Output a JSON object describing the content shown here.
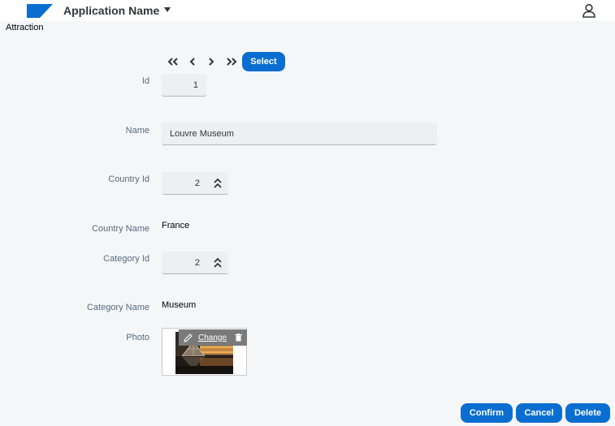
{
  "shell": {
    "app_name": "Application Name"
  },
  "page": {
    "title": "Attraction"
  },
  "nav": {
    "select_label": "Select"
  },
  "form": {
    "id": {
      "label": "Id",
      "value": "1"
    },
    "name": {
      "label": "Name",
      "value": "Louvre Museum"
    },
    "country_id": {
      "label": "Country Id",
      "value": "2"
    },
    "country_name": {
      "label": "Country Name",
      "value": "France"
    },
    "category_id": {
      "label": "Category Id",
      "value": "2"
    },
    "category_name": {
      "label": "Category Name",
      "value": "Museum"
    },
    "photo": {
      "label": "Photo",
      "change_label": "Change"
    }
  },
  "actions": {
    "confirm": "Confirm",
    "cancel": "Cancel",
    "delete": "Delete"
  },
  "colors": {
    "accent": "#0a6ed1",
    "background": "#f5f6f7",
    "field": "#edeff0"
  }
}
